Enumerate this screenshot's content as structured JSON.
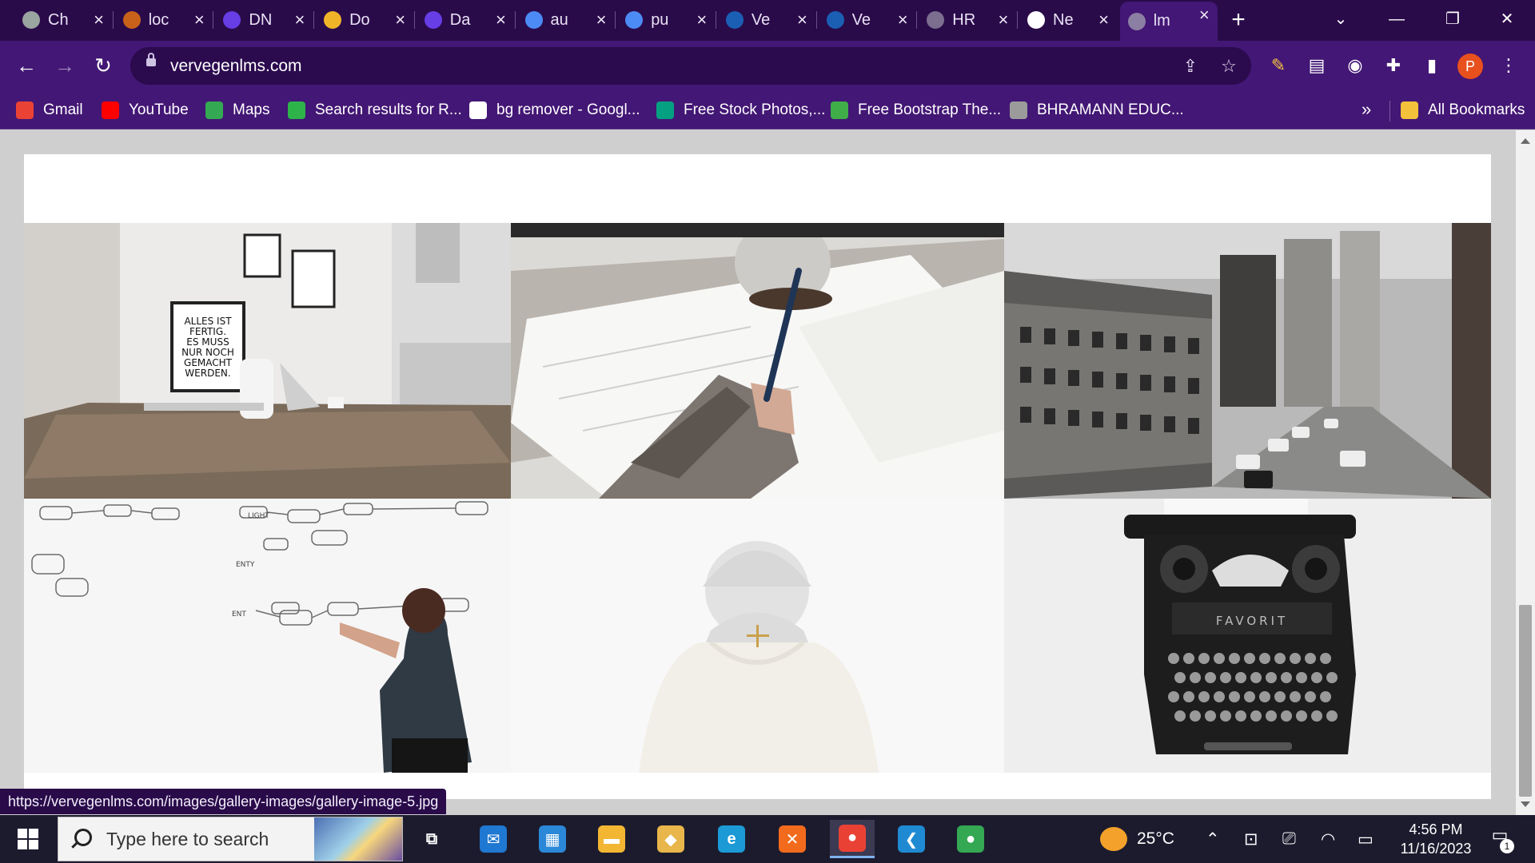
{
  "browser": {
    "tabs": [
      {
        "label": "Ch",
        "icon": "chatgpt-icon",
        "color": "#9aa4a0"
      },
      {
        "label": "loc",
        "icon": "stackedit-icon",
        "color": "#c8621a"
      },
      {
        "label": "DN",
        "icon": "hostinger-icon",
        "color": "#673de6"
      },
      {
        "label": "Do",
        "icon": "vervegen-icon",
        "color": "#f0b429"
      },
      {
        "label": "Da",
        "icon": "hostinger-icon",
        "color": "#673de6"
      },
      {
        "label": "au",
        "icon": "google-lens-icon",
        "color": "#4c8bf5"
      },
      {
        "label": "pu",
        "icon": "google-lens-icon",
        "color": "#4c8bf5"
      },
      {
        "label": "Ve",
        "icon": "vervegen-icon",
        "color": "#1a5fb4"
      },
      {
        "label": "Ve",
        "icon": "wordpress-icon",
        "color": "#1a5fb4"
      },
      {
        "label": "HR",
        "icon": "globe-icon",
        "color": "#7b6e8f"
      },
      {
        "label": "Ne",
        "icon": "chrome-icon",
        "color": "#ffffff"
      },
      {
        "label": "lm",
        "icon": "globe-icon",
        "color": "#8b7fa3"
      }
    ],
    "new_tab": "+",
    "window_controls": {
      "tab_search": "⌄",
      "minimize": "—",
      "restore": "❐",
      "close": "✕"
    },
    "toolbar": {
      "back": "←",
      "forward": "→",
      "reload": "↻"
    },
    "url": "vervegenlms.com",
    "profile_initial": "P",
    "bookmarks": [
      {
        "label": "Gmail",
        "icon": "gmail-icon",
        "color": "#ea4335"
      },
      {
        "label": "YouTube",
        "icon": "youtube-icon",
        "color": "#ff0000"
      },
      {
        "label": "Maps",
        "icon": "maps-icon",
        "color": "#34a853"
      },
      {
        "label": "Search results for R...",
        "icon": "vervegen-icon",
        "color": "#2db34a"
      },
      {
        "label": "bg remover - Googl...",
        "icon": "google-icon",
        "color": "#ffffff"
      },
      {
        "label": "Free Stock Photos,...",
        "icon": "pexels-icon",
        "color": "#05a081"
      },
      {
        "label": "Free Bootstrap The...",
        "icon": "leaf-icon",
        "color": "#3fae49"
      },
      {
        "label": "BHRAMANN EDUC...",
        "icon": "globe-icon",
        "color": "#9b9b9b"
      }
    ],
    "bookmarks_overflow": "»",
    "all_bookmarks": "All Bookmarks",
    "status_url": "https://vervegenlms.com/images/gallery-images/gallery-image-5.jpg"
  },
  "gallery": {
    "images": [
      {
        "alt": "gallery-image-1",
        "subject": "office desk with poster",
        "poster_text": [
          "ALLES IST",
          "FERTIG.",
          "ES MUSS",
          "NUR NOCH",
          "GEMACHT",
          "WERDEN."
        ]
      },
      {
        "alt": "gallery-image-2",
        "subject": "hand writing with pen"
      },
      {
        "alt": "gallery-image-3",
        "subject": "city street black and white"
      },
      {
        "alt": "gallery-image-4",
        "subject": "man drawing flowchart on whiteboard"
      },
      {
        "alt": "gallery-image-5",
        "subject": "person in beanie (hovered)",
        "hovered": true
      },
      {
        "alt": "gallery-image-6",
        "subject": "vintage typewriter",
        "brand_text": "FAVORIT"
      }
    ],
    "accent_color": "#c8a14a"
  },
  "taskbar": {
    "search_placeholder": "Type here to search",
    "apps": [
      {
        "name": "task-view-icon",
        "color": "#1c1b2e",
        "glyph": "⧉"
      },
      {
        "name": "mail-icon",
        "color": "#1f78d1",
        "glyph": "✉"
      },
      {
        "name": "microsoft-store-icon",
        "color": "#2b88d8",
        "glyph": "▦"
      },
      {
        "name": "file-explorer-icon",
        "color": "#f2b632",
        "glyph": "▬"
      },
      {
        "name": "package-icon",
        "color": "#e8b64a",
        "glyph": "◆"
      },
      {
        "name": "edge-icon",
        "color": "#1b9ad6",
        "glyph": "e"
      },
      {
        "name": "xampp-icon",
        "color": "#f26b1d",
        "glyph": "✕"
      },
      {
        "name": "chrome-icon",
        "color": "#e94235",
        "glyph": "●",
        "active": true
      },
      {
        "name": "vscode-icon",
        "color": "#1f8ad2",
        "glyph": "❮"
      },
      {
        "name": "chrome-profile-icon",
        "color": "#34a853",
        "glyph": "●"
      }
    ],
    "weather": "25°C",
    "time": "4:56 PM",
    "date": "11/16/2023",
    "notification_count": "1"
  }
}
